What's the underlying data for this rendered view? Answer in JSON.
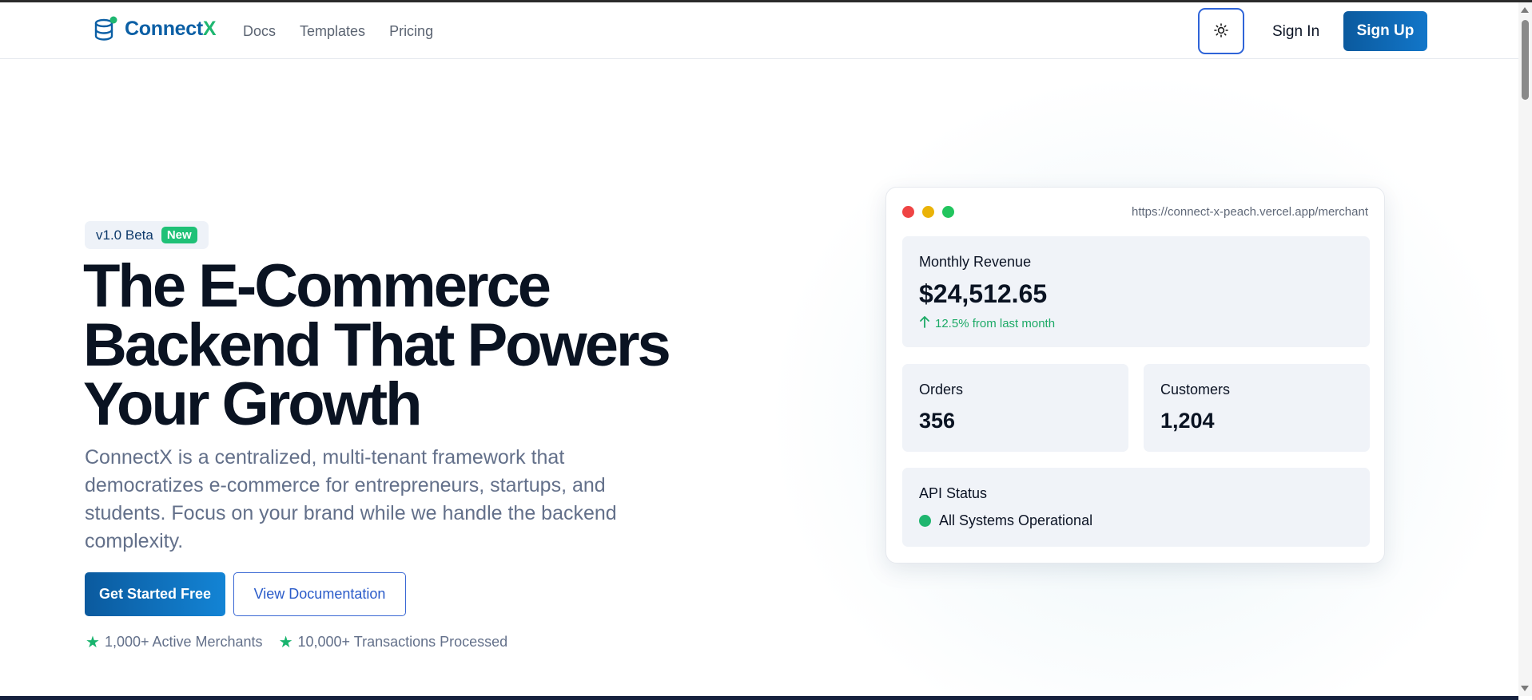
{
  "nav": {
    "brand_prefix": "Connect",
    "brand_suffix": "X",
    "links": [
      "Docs",
      "Templates",
      "Pricing"
    ],
    "theme_toggle_icon": "sun-icon",
    "signin_label": "Sign In",
    "signup_label": "Sign Up"
  },
  "hero": {
    "badge_version": "v1.0 Beta",
    "badge_new": "New",
    "headline_line1": "The E-Commerce",
    "headline_line2": "Backend That Powers",
    "headline_line3": "Your Growth",
    "subtext": "ConnectX is a centralized, multi-tenant framework that democratizes e-commerce for entrepreneurs, startups, and students. Focus on your brand while we handle the backend complexity.",
    "primary_cta": "Get Started Free",
    "secondary_cta": "View Documentation",
    "stats": [
      "1,000+ Active Merchants",
      "10,000+ Transactions Processed"
    ]
  },
  "dashboard": {
    "url": "https://connect-x-peach.vercel.app/merchant",
    "window_dot_colors": [
      "#ef4444",
      "#eab308",
      "#22c55e"
    ],
    "revenue_label": "Monthly Revenue",
    "revenue_value": "$24,512.65",
    "revenue_trend": "12.5% from last month",
    "orders_label": "Orders",
    "orders_value": "356",
    "customers_label": "Customers",
    "customers_value": "1,204",
    "api_label": "API Status",
    "api_status": "All Systems Operational"
  },
  "colors": {
    "brand_blue": "#0b5fa5",
    "brand_green": "#1fb771",
    "accent_green": "#1fc177",
    "cta_blue": "#0b5a9e",
    "outline_blue": "#3a68d4"
  }
}
